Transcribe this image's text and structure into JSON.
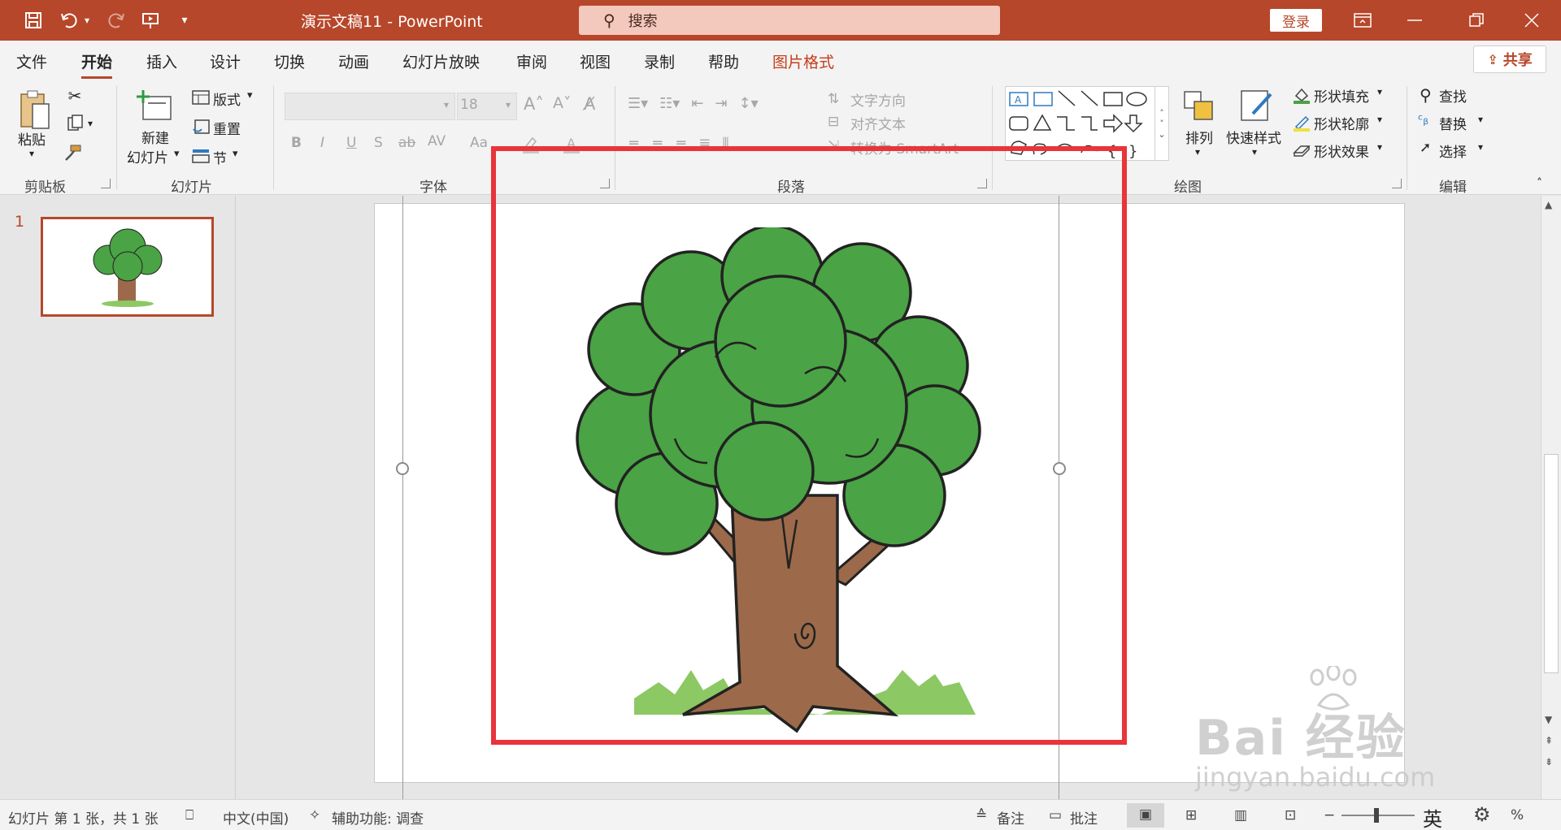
{
  "titlebar": {
    "doc_title": "演示文稿11  -  PowerPoint",
    "search_placeholder": "搜索",
    "login": "登录"
  },
  "tabs": [
    "文件",
    "开始",
    "插入",
    "设计",
    "切换",
    "动画",
    "幻灯片放映",
    "审阅",
    "视图",
    "录制",
    "帮助",
    "图片格式"
  ],
  "active_tab": "开始",
  "share": "共享",
  "ribbon": {
    "clipboard": {
      "paste": "粘贴",
      "label": "剪贴板"
    },
    "slides": {
      "new_slide_line1": "新建",
      "new_slide_line2": "幻灯片",
      "layout": "版式",
      "reset": "重置",
      "section": "节",
      "label": "幻灯片"
    },
    "font": {
      "size": "18",
      "bold": "B",
      "italic": "I",
      "underline": "U",
      "shadow": "S",
      "strike": "ab",
      "spacing": "AV",
      "case": "Aa",
      "label": "字体"
    },
    "paragraph": {
      "text_direction": "文字方向",
      "align_text": "对齐文本",
      "smartart": "转换为 SmartArt",
      "label": "段落"
    },
    "drawing": {
      "arrange": "排列",
      "quick_styles": "快速样式",
      "shape_fill": "形状填充",
      "shape_outline": "形状轮廓",
      "shape_effects": "形状效果",
      "label": "绘图"
    },
    "editing": {
      "find": "查找",
      "replace": "替换",
      "select": "选择",
      "label": "编辑"
    }
  },
  "thumbnails": [
    {
      "number": "1"
    }
  ],
  "statusbar": {
    "slide_info": "幻灯片 第 1 张，共 1 张",
    "language": "中文(中国)",
    "accessibility": "辅助功能: 调查",
    "notes": "备注",
    "comments": "批注",
    "ime": "英",
    "zoom_suffix": "%"
  },
  "watermark": {
    "brand": "Bai  经验",
    "url": "jingyan.baidu.com"
  },
  "colors": {
    "accent": "#b7472a",
    "highlight": "#e8343a",
    "tree_green": "#4aa344",
    "trunk": "#9c6a4a"
  }
}
